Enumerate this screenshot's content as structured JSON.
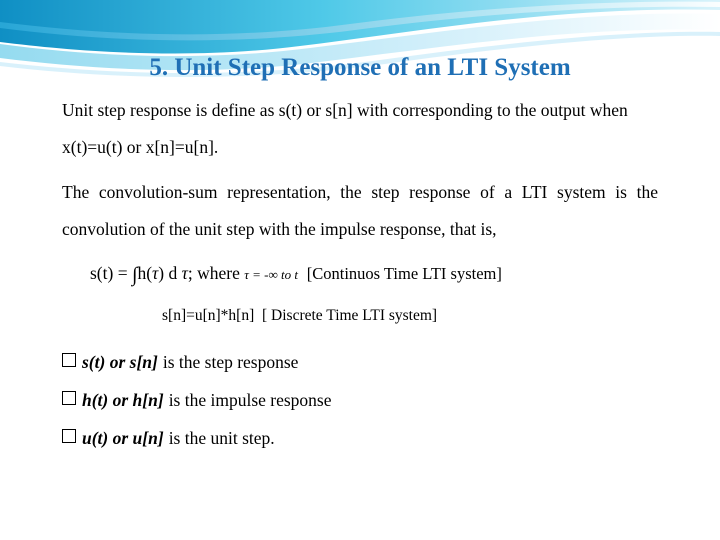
{
  "slide": {
    "title": "5. Unit Step Response of an LTI System",
    "paragraph1": "Unit step response is define as s(t) or s[n] with corresponding to the output when x(t)=u(t) or x[n]=u[n].",
    "paragraph2": "The convolution-sum representation, the step response of a LTI system is the convolution of the unit step with the impulse response, that is,",
    "equation_continuous": {
      "lhs": "s(t) = ",
      "integral": "∫",
      "body": "h(",
      "tau1": "τ",
      "mid": ") d ",
      "tau2": "τ",
      "where": "; where ",
      "condition": "τ = -∞ to t",
      "note": "[Continuos Time LTI system]"
    },
    "equation_discrete": {
      "expression": "s[n]=u[n]*h[n]",
      "note": "[ Discrete Time LTI system]"
    },
    "bullets": [
      {
        "lead": "s(t) or s[n]",
        "rest": "is the step response"
      },
      {
        "lead": "h(t) or h[n]",
        "rest": "is the impulse response"
      },
      {
        "lead": "u(t) or u[n]",
        "rest": "is the unit step."
      }
    ]
  },
  "colors": {
    "title": "#1f6fb5",
    "accent_cyan": "#46c7e8",
    "accent_blue": "#1f6fb5",
    "accent_light": "#bfe9f5"
  }
}
